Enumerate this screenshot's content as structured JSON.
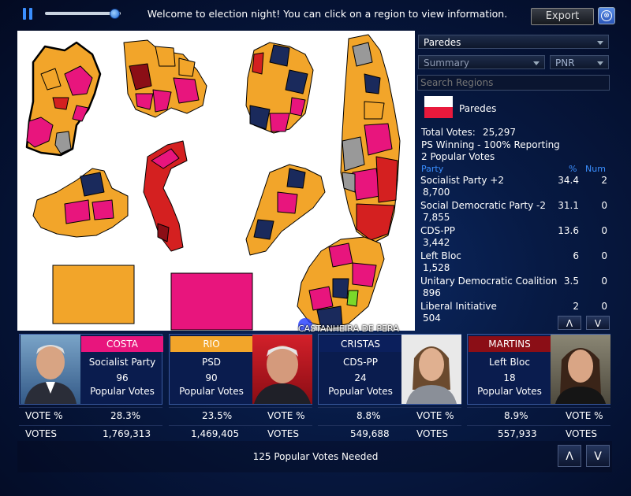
{
  "toolbar": {
    "welcome": "Welcome to election night! You can click on a region to view information.",
    "export_label": "Export",
    "close_symbol": "⊗",
    "playback_progress": 0.92
  },
  "map": {
    "overlay_label": "CASTANHEIRA DE PERA"
  },
  "panel": {
    "region_dropdown": "Paredes",
    "view_dropdown": "Summary",
    "party_dropdown": "PNR",
    "search_placeholder": "Search Regions",
    "region_name": "Paredes",
    "total_votes_label": "Total Votes:",
    "total_votes_value": "25,297",
    "winning_line": "PS Winning - 100% Reporting",
    "popular_line": "2 Popular Votes",
    "col_party": "Party",
    "col_pct": "%",
    "col_num": "Num",
    "results": [
      {
        "name": "Socialist Party +2",
        "votes": "8,700",
        "pct": "34.4",
        "num": "2"
      },
      {
        "name": "Social Democratic Party -2",
        "votes": "7,855",
        "pct": "31.1",
        "num": "0"
      },
      {
        "name": "CDS-PP",
        "votes": "3,442",
        "pct": "13.6",
        "num": "0"
      },
      {
        "name": "Left Bloc",
        "votes": "1,528",
        "pct": "6",
        "num": "0"
      },
      {
        "name": "Unitary Democratic Coalition",
        "votes": "896",
        "pct": "3.5",
        "num": "0"
      },
      {
        "name": "Liberal Initiative",
        "votes": "504",
        "pct": "2",
        "num": "0"
      }
    ],
    "up_label": "Λ",
    "down_label": "V"
  },
  "candidates": [
    {
      "name": "COSTA",
      "party": "Socialist Party",
      "seats": "96",
      "seats_label": "Popular Votes",
      "vote_pct": "28.3%",
      "votes": "1,769,313",
      "color": "#e8157d"
    },
    {
      "name": "RIO",
      "party": "PSD",
      "seats": "90",
      "seats_label": "Popular Votes",
      "vote_pct": "23.5%",
      "votes": "1,469,405",
      "color": "#f2a52a"
    },
    {
      "name": "CRISTAS",
      "party": "CDS-PP",
      "seats": "24",
      "seats_label": "Popular Votes",
      "vote_pct": "8.8%",
      "votes": "549,688",
      "color": "#0b1f5c"
    },
    {
      "name": "MARTINS",
      "party": "Left Bloc",
      "seats": "18",
      "seats_label": "Popular Votes",
      "vote_pct": "8.9%",
      "votes": "557,933",
      "color": "#8b0e16"
    }
  ],
  "stats_labels": {
    "vote_pct": "VOTE %",
    "votes": "VOTES"
  },
  "footer": {
    "needed": "125 Popular Votes Needed",
    "up_label": "Λ",
    "down_label": "V"
  },
  "colors": {
    "ps": "#e8157d",
    "psd": "#f2a52a",
    "cds": "#1a2a5c",
    "be": "#d42020",
    "grey": "#999999",
    "accent": "#3b8fff"
  }
}
